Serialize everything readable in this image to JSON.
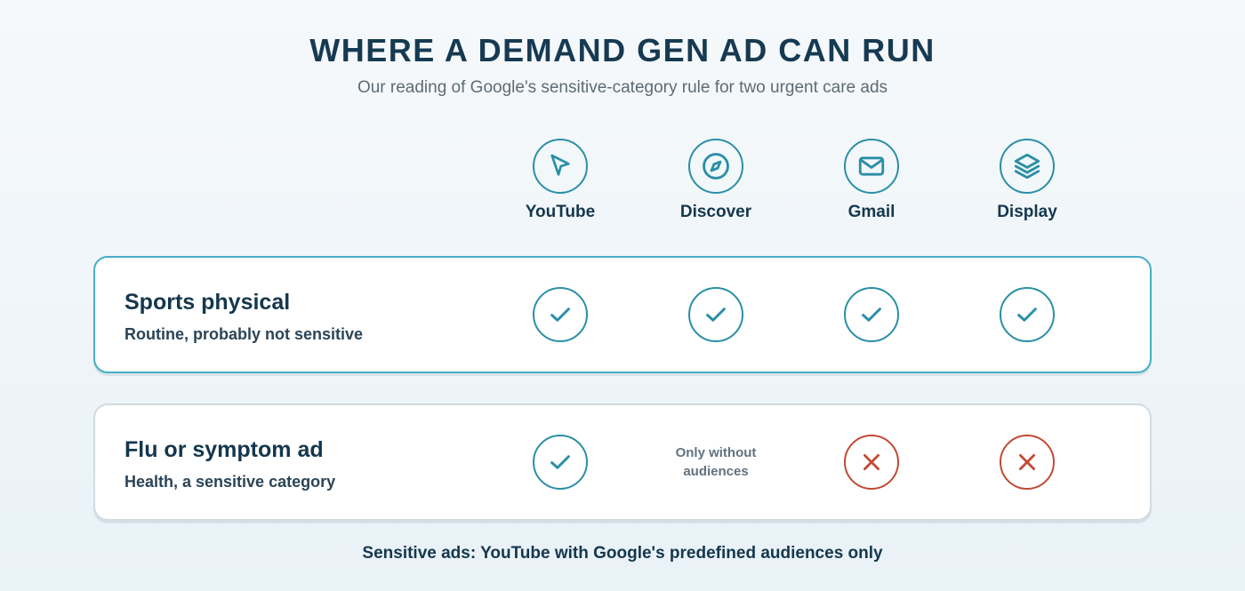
{
  "header": {
    "title": "WHERE A DEMAND GEN AD CAN RUN",
    "subtitle": "Our reading of Google's sensitive-category rule for two urgent care ads"
  },
  "columns": [
    {
      "label": "YouTube",
      "icon": "navigation-arrow-icon"
    },
    {
      "label": "Discover",
      "icon": "compass-icon"
    },
    {
      "label": "Gmail",
      "icon": "mail-icon"
    },
    {
      "label": "Display",
      "icon": "layers-icon"
    }
  ],
  "rows": [
    {
      "title": "Sports physical",
      "subtitle": "Routine, probably not sensitive",
      "cells": [
        {
          "status": "check"
        },
        {
          "status": "check"
        },
        {
          "status": "check"
        },
        {
          "status": "check"
        }
      ]
    },
    {
      "title": "Flu or symptom ad",
      "subtitle": "Health, a sensitive category",
      "cells": [
        {
          "status": "check"
        },
        {
          "status": "note",
          "note": "Only without audiences"
        },
        {
          "status": "cross"
        },
        {
          "status": "cross"
        }
      ]
    }
  ],
  "footer": "Sensitive ads: YouTube with Google's predefined audiences only",
  "colors": {
    "teal": "#2a8fa6",
    "red": "#c24a35",
    "navy": "#14374d"
  }
}
